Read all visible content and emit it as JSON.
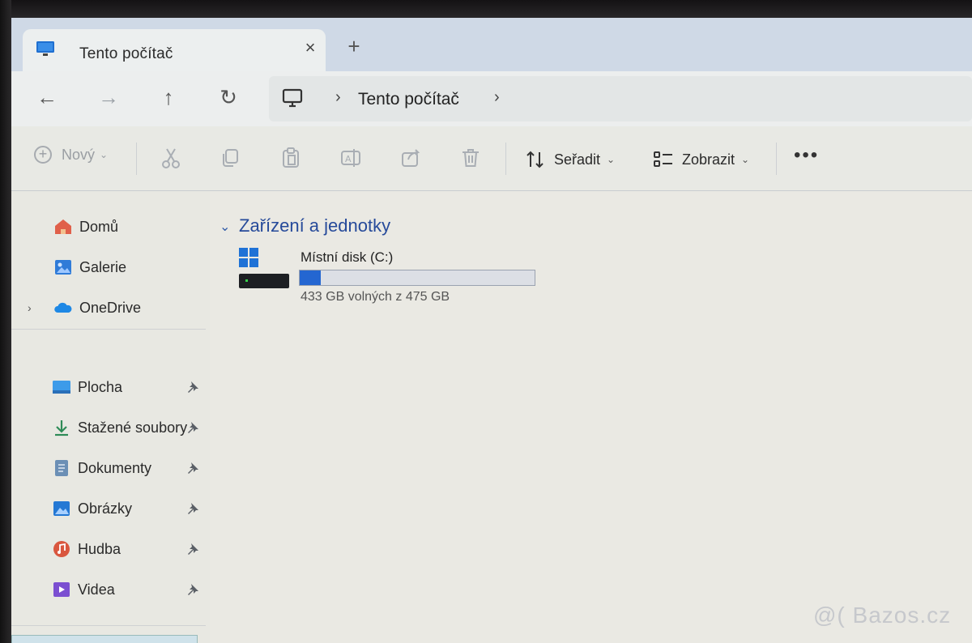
{
  "window": {
    "tab_title": "Tento počítač",
    "tab_close": "×",
    "new_tab": "+"
  },
  "navigation": {
    "back": "←",
    "forward": "→",
    "up": "↑",
    "refresh": "↻",
    "breadcrumb_sep": "›",
    "breadcrumb_label": "Tento počítač"
  },
  "toolbar": {
    "new_label": "Nový",
    "sort_label": "Seřadit",
    "view_label": "Zobrazit",
    "more_label": "•••",
    "caret": "⌄"
  },
  "sidebar": {
    "top_items": [
      {
        "label": "Domů",
        "icon": "home-icon"
      },
      {
        "label": "Galerie",
        "icon": "gallery-icon"
      },
      {
        "label": "OneDrive",
        "icon": "onedrive-icon"
      }
    ],
    "onedrive_chevron": "›",
    "pinned_items": [
      {
        "label": "Plocha",
        "icon": "desktop-icon"
      },
      {
        "label": "Stažené soubory",
        "icon": "download-icon"
      },
      {
        "label": "Dokumenty",
        "icon": "documents-icon"
      },
      {
        "label": "Obrázky",
        "icon": "pictures-icon"
      },
      {
        "label": "Hudba",
        "icon": "music-icon"
      },
      {
        "label": "Videa",
        "icon": "videos-icon"
      }
    ]
  },
  "main": {
    "group_chevron": "⌄",
    "group_title": "Zařízení a jednotky",
    "drives": [
      {
        "name": "Místní disk (C:)",
        "free_text": "433 GB volných z 475 GB",
        "used_fraction": 0.09
      }
    ]
  },
  "watermark": "@( Bazos.cz",
  "colors": {
    "accent": "#2466d1",
    "group_title": "#264a9a",
    "window_bg": "#e9e9e3",
    "tabstrip_bg": "#cfd9e6"
  }
}
